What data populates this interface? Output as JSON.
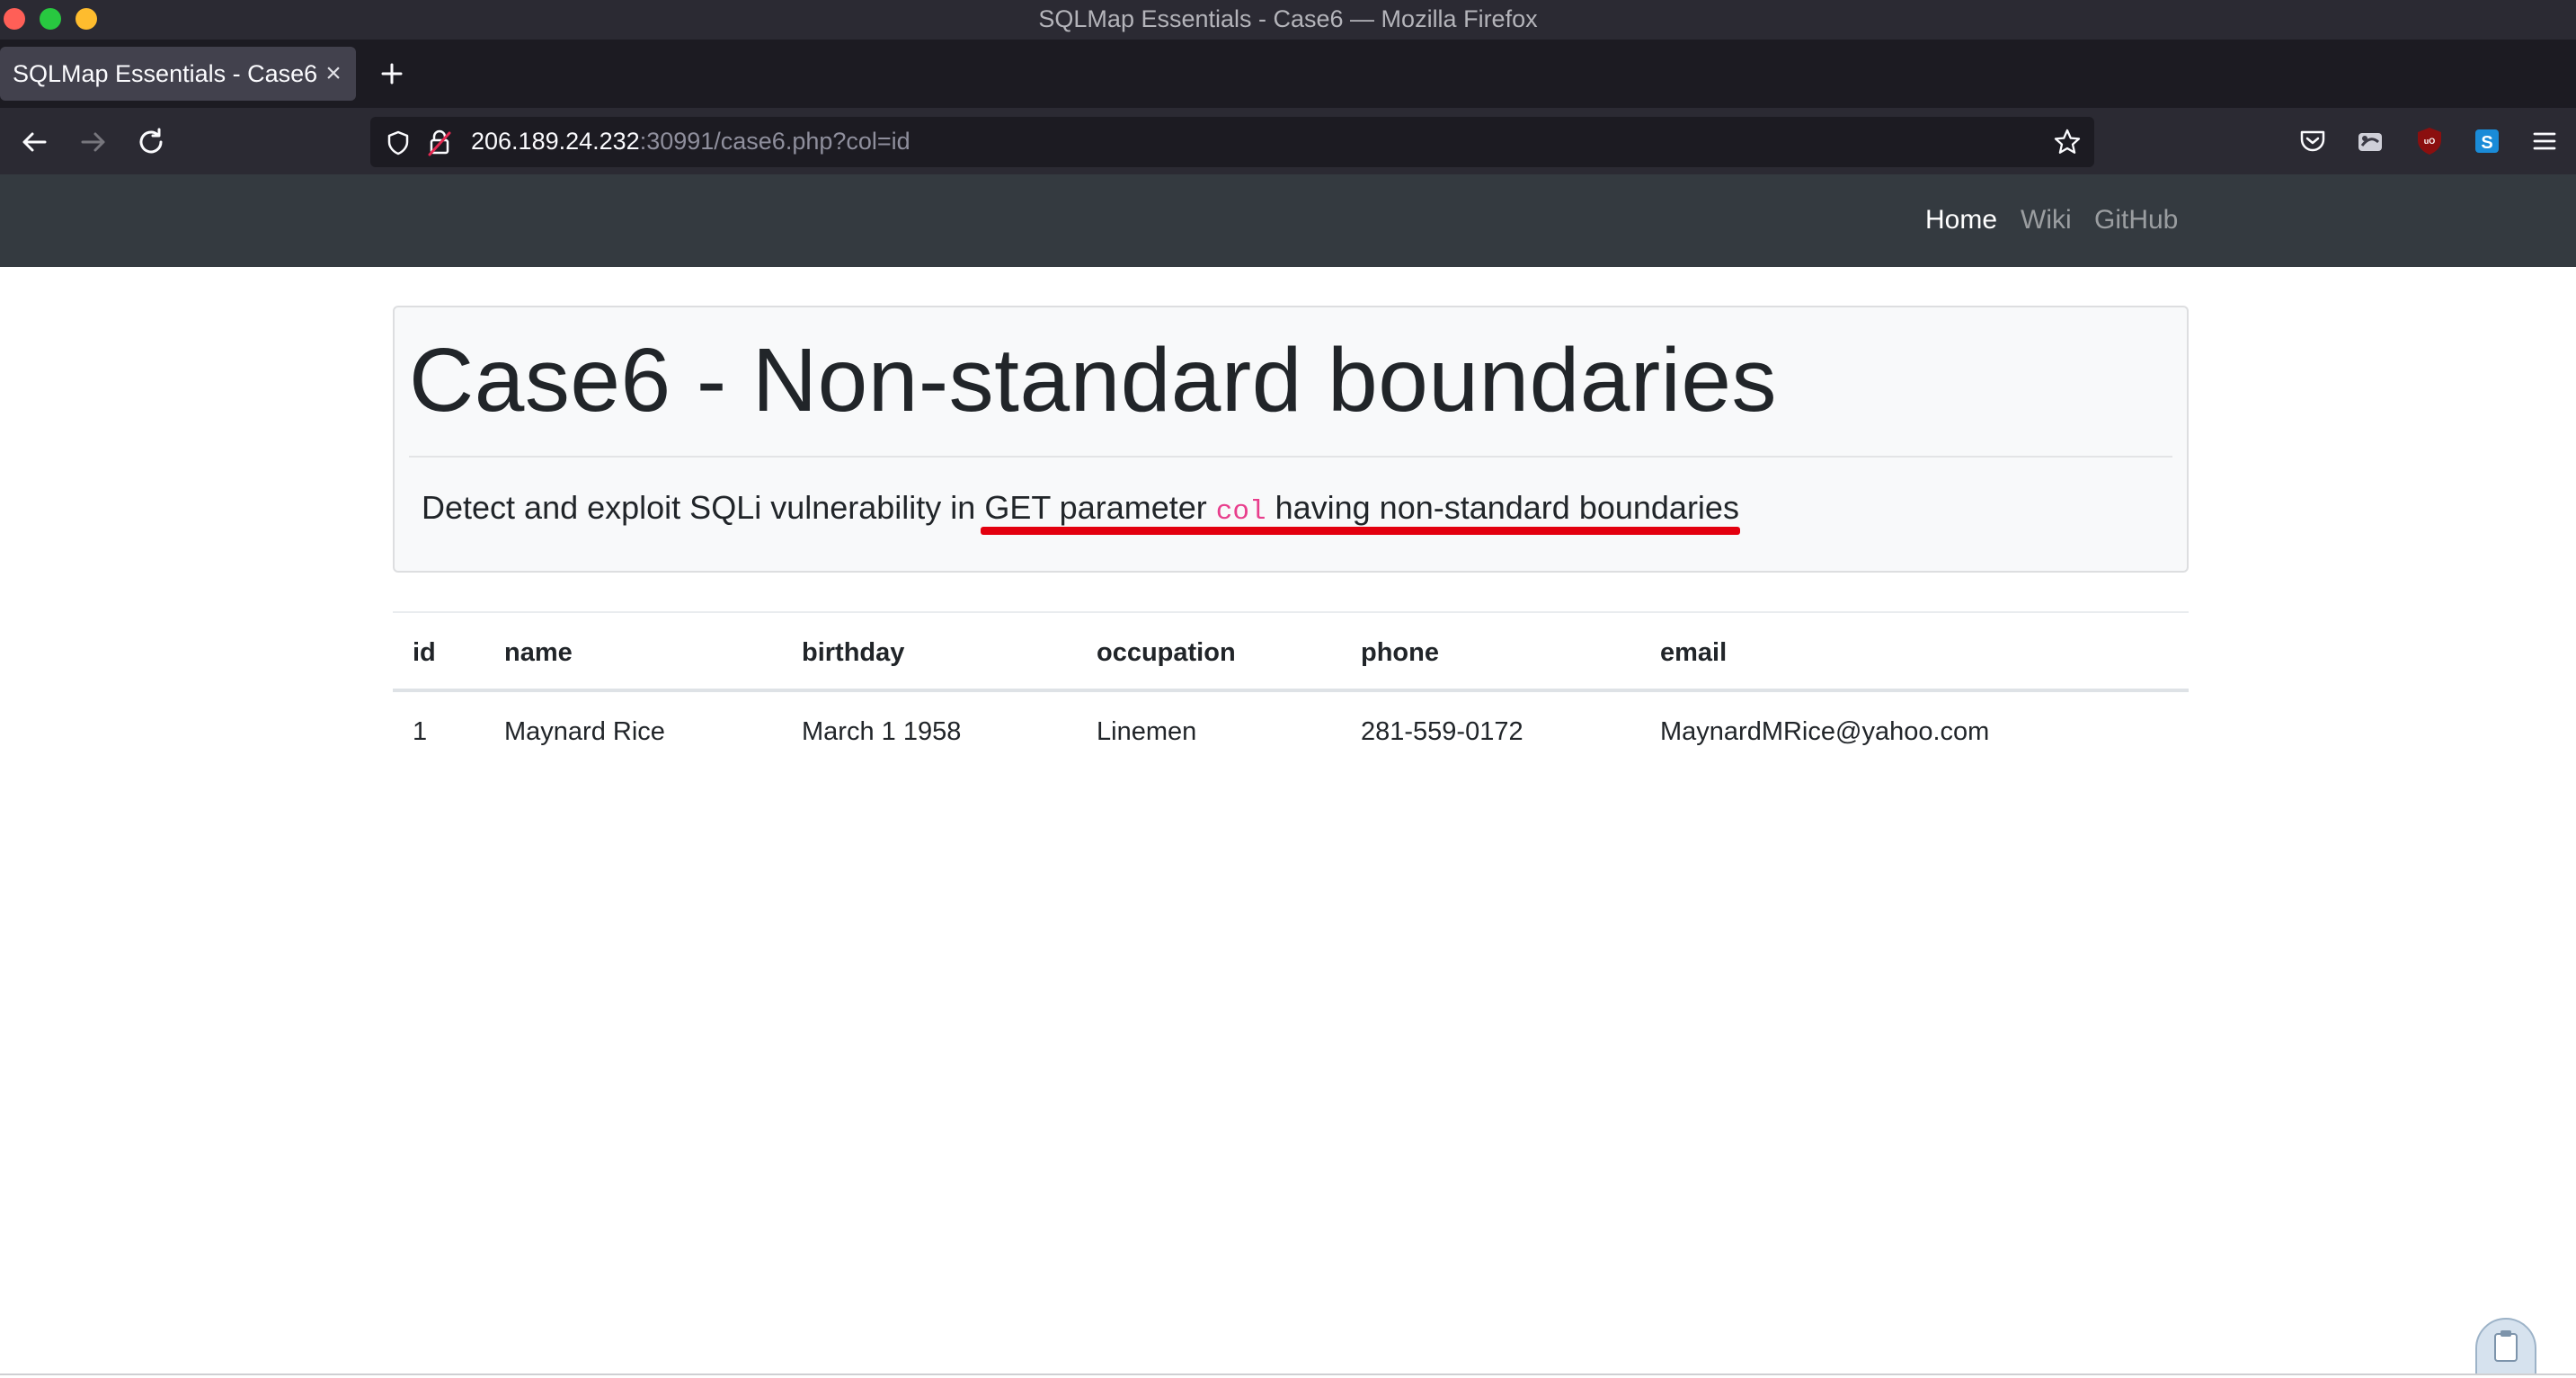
{
  "window": {
    "title": "SQLMap Essentials - Case6 — Mozilla Firefox"
  },
  "tabs": [
    {
      "title": "SQLMap Essentials - Case6",
      "close": "×"
    }
  ],
  "urlbar": {
    "host": "206.189.24.232",
    "rest": ":30991/case6.php?col=id"
  },
  "toolbar_icons": [
    "pocket-icon",
    "extension-icon",
    "ublock-icon",
    "skype-extension-icon",
    "menu-icon"
  ],
  "site_nav": {
    "links": [
      "Home",
      "Wiki",
      "GitHub"
    ],
    "active": "Home"
  },
  "jumbotron": {
    "title": "Case6 - Non-standard boundaries",
    "lead_before": "Detect and exploit SQLi vulnerability in GET parameter ",
    "lead_code": "col",
    "lead_after": " having non-standard boundaries",
    "highlight_color": "#e3000f"
  },
  "table": {
    "headers": [
      "id",
      "name",
      "birthday",
      "occupation",
      "phone",
      "email"
    ],
    "rows": [
      [
        "1",
        "Maynard Rice",
        "March 1 1958",
        "Linemen",
        "281-559-0172",
        "MaynardMRice@yahoo.com"
      ]
    ]
  },
  "colors": {
    "chrome_bg": "#2b2a33",
    "site_nav_bg": "#343a40",
    "code_pink": "#e83e8c"
  }
}
